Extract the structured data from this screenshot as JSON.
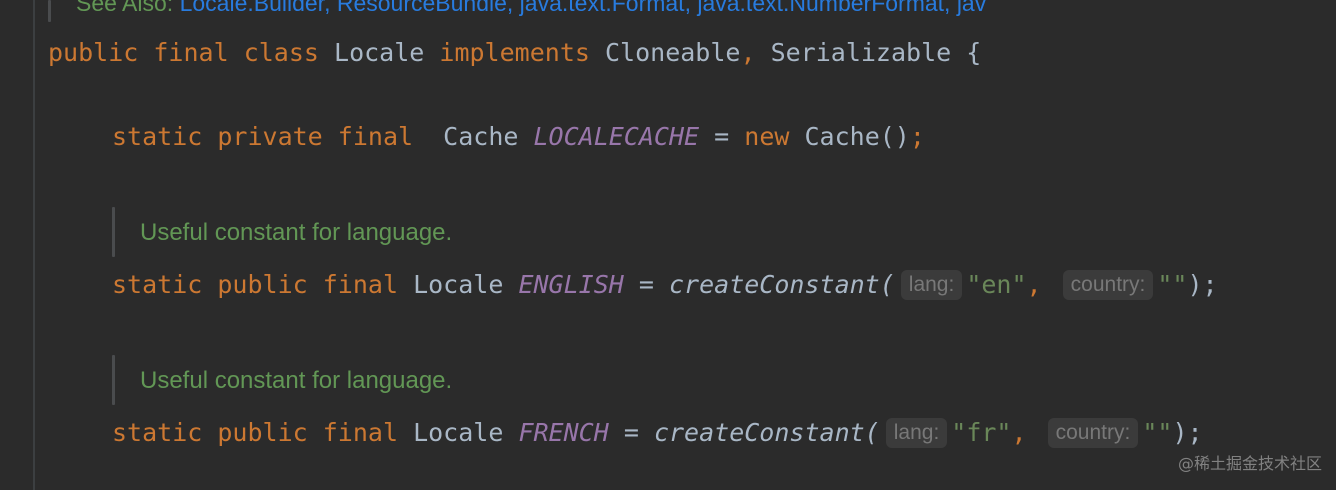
{
  "see_also": {
    "label": "See Also:",
    "links": "Locale.Builder, ResourceBundle, java.text.Format, java.text.NumberFormat, jav"
  },
  "class_decl": {
    "kw_public": "public",
    "kw_final": "final",
    "kw_class": "class",
    "name": "Locale",
    "kw_implements": "implements",
    "iface1": "Cloneable",
    "comma": ",",
    "iface2": "Serializable",
    "brace": "{"
  },
  "cache_line": {
    "kw_static": "static",
    "kw_private": "private",
    "kw_final": "final",
    "type": "Cache",
    "field": "LOCALECACHE",
    "assign": "=",
    "kw_new": "new",
    "ctor": "Cache()",
    "semi": ";"
  },
  "doc1": "Useful constant for language.",
  "english_line": {
    "kw_static": "static",
    "kw_public": "public",
    "kw_final": "final",
    "type": "Locale",
    "field": "ENGLISH",
    "assign": "=",
    "method": "createConstant(",
    "hint_lang": "lang:",
    "arg_lang": "\"en\"",
    "comma": ",",
    "hint_country": "country:",
    "arg_country": "\"\"",
    "close": ");"
  },
  "doc2": "Useful constant for language.",
  "french_line": {
    "kw_static": "static",
    "kw_public": "public",
    "kw_final": "final",
    "type": "Locale",
    "field": "FRENCH",
    "assign": "=",
    "method": "createConstant(",
    "hint_lang": "lang:",
    "arg_lang": "\"fr\"",
    "comma": ",",
    "hint_country": "country:",
    "arg_country": "\"\"",
    "close": ");"
  },
  "watermark": "@稀土掘金技术社区",
  "colors": {
    "background": "#2b2b2b",
    "keyword": "#cc7832",
    "constant": "#9876aa",
    "string": "#6a8759",
    "doc_comment": "#629755",
    "link": "#287bde"
  }
}
